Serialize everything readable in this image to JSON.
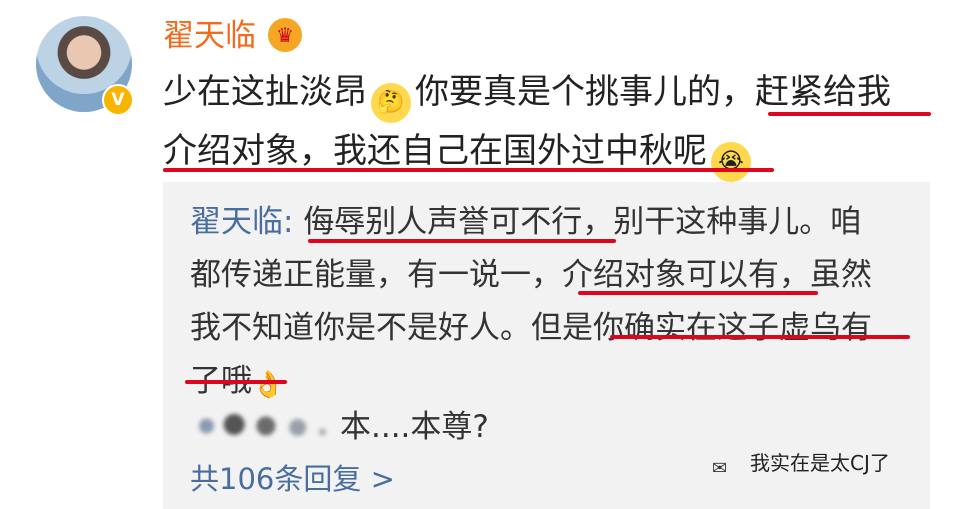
{
  "comment": {
    "username": "翟天临",
    "vip_icon": "crown-vip-icon",
    "verified_icon": "verified-v-icon",
    "text": {
      "line1_start": "少在这扯淡昂",
      "line1_middle": "你要真是个挑事儿的，",
      "line1_highlight": "赶紧给我",
      "line2_highlight": "介绍对象，我还自己在国外过中秋呢"
    },
    "emoji1": "thinking-face-icon",
    "emoji2": "crying-face-icon"
  },
  "reply": {
    "author": "翟天临",
    "colon": ":",
    "part1": "侮辱别人声誉可不行",
    "part2": "，别干这种事儿。咱",
    "part3": "都传递正能量，有一说一，",
    "part4": "介绍对象可以有",
    "part5": "，虽然",
    "part6": "我不知道你是不是好人。但是",
    "part7": "你确实在这子虚乌有",
    "part8": "了哦",
    "emoji": "fist-bump-icon"
  },
  "second_reply": {
    "author_blurred": "",
    "text": "本....本尊?"
  },
  "more_replies": "共106条回复 >",
  "watermark": "我实在是太CJ了",
  "colors": {
    "username": "#f26b1c",
    "link": "#4a6da0",
    "underline": "#e0051f",
    "reply_bg": "#f2f2f2"
  }
}
